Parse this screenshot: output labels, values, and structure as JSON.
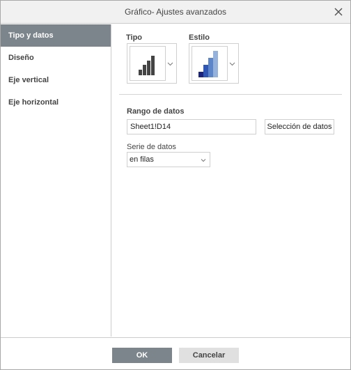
{
  "dialog": {
    "title": "Gráfico- Ajustes avanzados"
  },
  "sidebar": {
    "items": [
      {
        "label": "Tipo y datos",
        "active": true
      },
      {
        "label": "Diseño",
        "active": false
      },
      {
        "label": "Eje vertical",
        "active": false
      },
      {
        "label": "Eje horizontal",
        "active": false
      }
    ]
  },
  "main": {
    "type_label": "Tipo",
    "style_label": "Estilo",
    "type_icon": "bar-chart-icon",
    "style_icon": "bar-chart-style-icon",
    "style_colors": [
      "#1a237e",
      "#2f55b5",
      "#5d86c9",
      "#95b2dc"
    ],
    "range_label": "Rango de datos",
    "range_value": "Sheet1!D14",
    "select_data_button": "Selección de datos",
    "series_label": "Serie de datos",
    "series_value": "en filas"
  },
  "footer": {
    "ok_label": "OK",
    "cancel_label": "Cancelar"
  },
  "colors": {
    "accent": "#7d858c",
    "cancel_bg": "#e0e0e0"
  }
}
